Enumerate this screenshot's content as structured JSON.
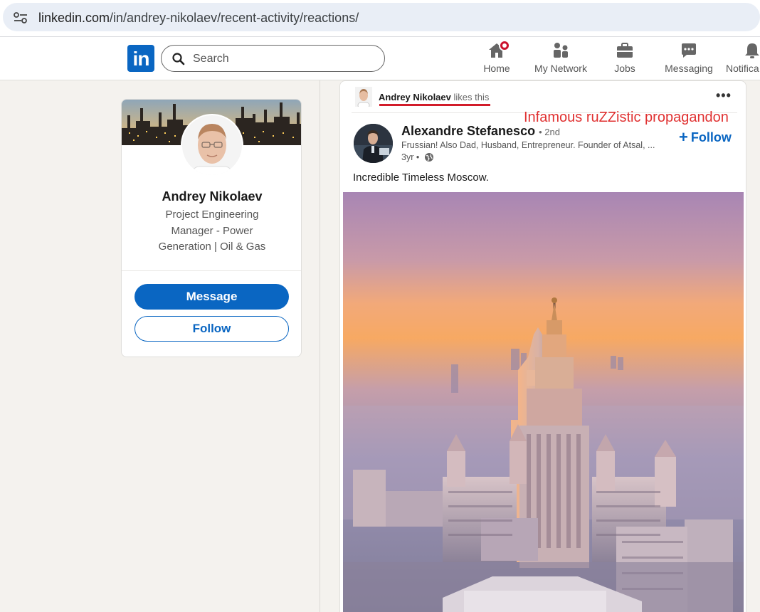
{
  "browser": {
    "url_domain": "linkedin.com",
    "url_path": "/in/andrey-nikolaev/recent-activity/reactions/",
    "tune_icon": "site-settings-icon"
  },
  "nav": {
    "logo_text": "in",
    "search_placeholder": "Search",
    "items": [
      {
        "label": "Home",
        "icon": "home-icon"
      },
      {
        "label": "My Network",
        "icon": "network-icon"
      },
      {
        "label": "Jobs",
        "icon": "briefcase-icon"
      },
      {
        "label": "Messaging",
        "icon": "messaging-icon"
      },
      {
        "label": "Notifica",
        "icon": "bell-icon"
      }
    ],
    "brand_color": "#0a66c2"
  },
  "profile": {
    "name": "Andrey Nikolaev",
    "headline": "Project Engineering Manager - Power Generation | Oil & Gas",
    "message_label": "Message",
    "follow_label": "Follow"
  },
  "post": {
    "liker_name": "Andrey Nikolaev",
    "liker_action": "likes this",
    "annotation": "Infamous ruZZistic propagandon",
    "author_name": "Alexandre Stefanesco",
    "author_degree": "• 2nd",
    "author_headline": "Frussian! Also Dad, Husband, Entrepreneur. Founder of Atsal, ...",
    "time": "3yr •",
    "follow_label": "Follow",
    "text": "Incredible Timeless Moscow.",
    "annotation_color": "#e03131"
  }
}
